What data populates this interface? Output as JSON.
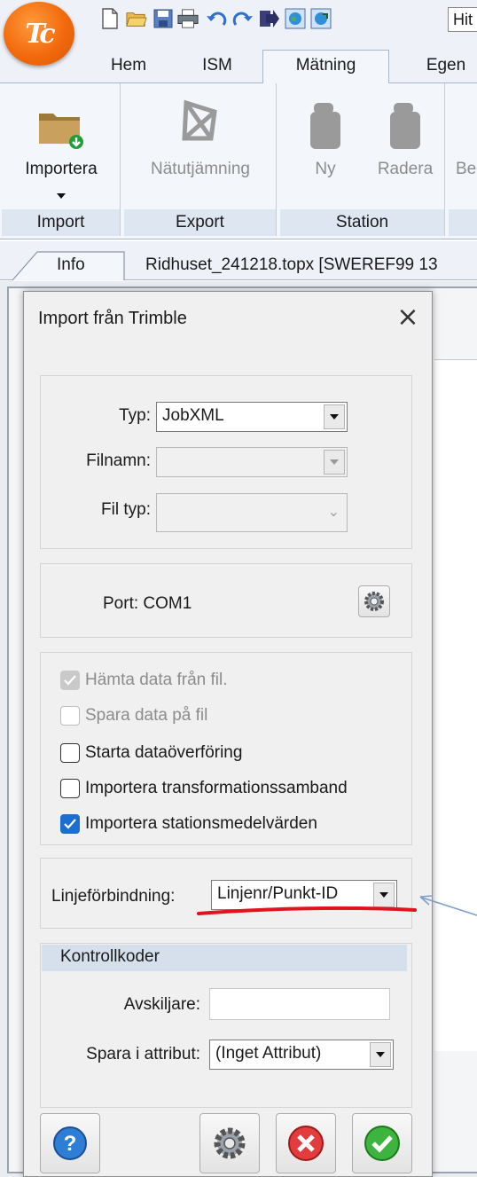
{
  "quick_access": {
    "search_text": "Hit",
    "icons": [
      "new-icon",
      "open-folder-icon",
      "save-icon",
      "print-icon",
      "undo-icon",
      "redo-icon",
      "import-arrow-icon",
      "globe-icon",
      "globe-export-icon"
    ]
  },
  "ribbon_tabs": [
    {
      "label": "Hem",
      "active": false
    },
    {
      "label": "ISM",
      "active": false
    },
    {
      "label": "Mätning",
      "active": true
    },
    {
      "label": "Egen",
      "active": false
    }
  ],
  "ribbon": {
    "groups": [
      {
        "label": "Import",
        "buttons": [
          {
            "label": "Importera",
            "icon": "folder-import-icon",
            "enabled": true,
            "has_dropdown": true
          }
        ]
      },
      {
        "label": "Export",
        "buttons": [
          {
            "label": "Nätutjämning",
            "icon": "network-adjust-icon",
            "enabled": false
          }
        ]
      },
      {
        "label": "Station",
        "buttons": [
          {
            "label": "Ny",
            "icon": "station-new-icon",
            "enabled": false
          },
          {
            "label": "Radera",
            "icon": "station-delete-icon",
            "enabled": false
          }
        ]
      },
      {
        "label": "",
        "buttons": [
          {
            "label": "Be",
            "icon": "",
            "enabled": false
          }
        ]
      }
    ]
  },
  "document_tabs": [
    {
      "label": "Info"
    },
    {
      "label": "Ridhuset_241218.topx [SWEREF99 13"
    }
  ],
  "dialog": {
    "title": "Import från Trimble",
    "close_glyph": "×",
    "source": {
      "type_label": "Typ:",
      "type_value": "JobXML",
      "filename_label": "Filnamn:",
      "filename_value": "",
      "filetype_label": "Fil typ:",
      "filetype_value": ""
    },
    "port": {
      "label": "Port: COM1"
    },
    "options": [
      {
        "label": "Hämta data från fil.",
        "checked": true,
        "enabled": false
      },
      {
        "label": "Spara data på fil",
        "checked": false,
        "enabled": false
      },
      {
        "label": "Starta dataöverföring",
        "checked": false,
        "enabled": true
      },
      {
        "label": "Importera transformationssamband",
        "checked": false,
        "enabled": true
      },
      {
        "label": "Importera stationsmedelvärden",
        "checked": true,
        "enabled": true
      }
    ],
    "line_connection": {
      "label": "Linjeförbindning:",
      "value": "Linjenr/Punkt-ID"
    },
    "control_codes": {
      "header": "Kontrollkoder",
      "separator_label": "Avskiljare:",
      "separator_value": "",
      "save_attr_label": "Spara i attribut:",
      "save_attr_value": "(Inget Attribut)"
    },
    "buttons": [
      "help-button",
      "settings-button",
      "cancel-button",
      "ok-button"
    ]
  },
  "colors": {
    "accent_orange": "#f26a0c",
    "checkbox_blue": "#1a6fd1",
    "annotation_red": "#e0141e",
    "annotation_arrow": "#7f9fc4"
  }
}
